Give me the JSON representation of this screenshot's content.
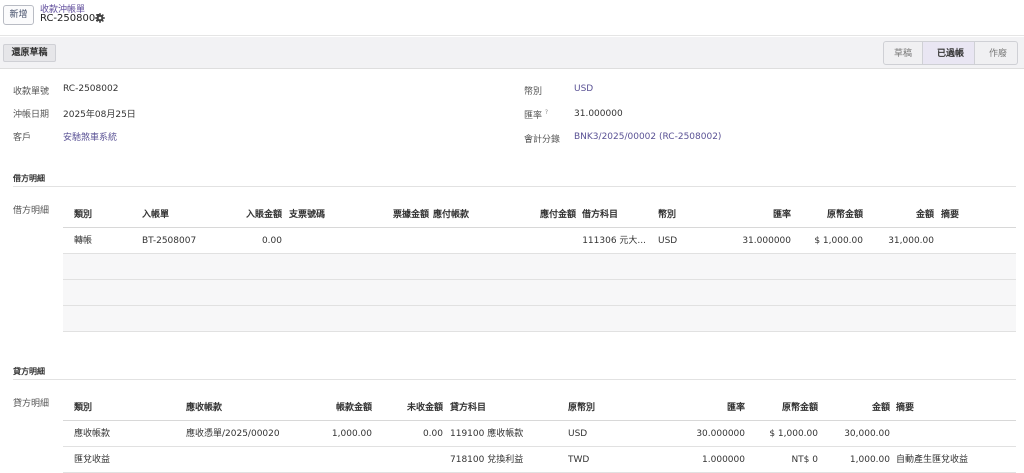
{
  "topbar": {
    "new_label": "新增",
    "breadcrumb_parent": "收款沖帳單",
    "breadcrumb_current": "RC-2508002"
  },
  "statusbar": {
    "reset_label": "還原草稿",
    "stages": [
      "草稿",
      "已過帳",
      "作廢"
    ],
    "active_stage": "已過帳"
  },
  "form": {
    "receipt_no_label": "收款單號",
    "receipt_no": "RC-2508002",
    "date_label": "沖帳日期",
    "date": "2025年08月25日",
    "customer_label": "客戶",
    "customer": "安馳煞車系統",
    "currency_label": "幣別",
    "currency": "USD",
    "rate_label": "匯率",
    "rate_help": "?",
    "rate": "31.000000",
    "journal_label": "會計分錄",
    "journal": "BNK3/2025/00002 (RC-2508002)"
  },
  "debit": {
    "section_title": "借方明細",
    "field_label": "借方明細",
    "headers": [
      "類別",
      "入帳單",
      "入賬金額",
      "支票號碼",
      "票據金額",
      "應付帳款",
      "應付金額",
      "借方科目",
      "幣別",
      "匯率",
      "原幣金額",
      "金額",
      "摘要"
    ],
    "rows": [
      [
        "轉帳",
        "BT-2508007",
        "0.00",
        "",
        "",
        "",
        "",
        "111306 元大...",
        "USD",
        "31.000000",
        "$ 1,000.00",
        "31,000.00",
        ""
      ]
    ]
  },
  "credit": {
    "section_title": "貸方明細",
    "field_label": "貸方明細",
    "headers": [
      "類別",
      "應收帳款",
      "帳款金額",
      "未收金額",
      "貸方科目",
      "原幣別",
      "匯率",
      "原幣金額",
      "金額",
      "摘要"
    ],
    "rows": [
      [
        "應收帳款",
        "應收憑單/2025/00020",
        "1,000.00",
        "0.00",
        "119100 應收帳款",
        "USD",
        "30.000000",
        "$ 1,000.00",
        "30,000.00",
        ""
      ],
      [
        "匯兌收益",
        "",
        "",
        "",
        "718100 兌換利益",
        "TWD",
        "1.000000",
        "NT$ 0",
        "1,000.00",
        "自動產生匯兌收益"
      ]
    ]
  },
  "colors": {
    "link": "#5a5295",
    "accent_bg": "#e9e6f3"
  }
}
